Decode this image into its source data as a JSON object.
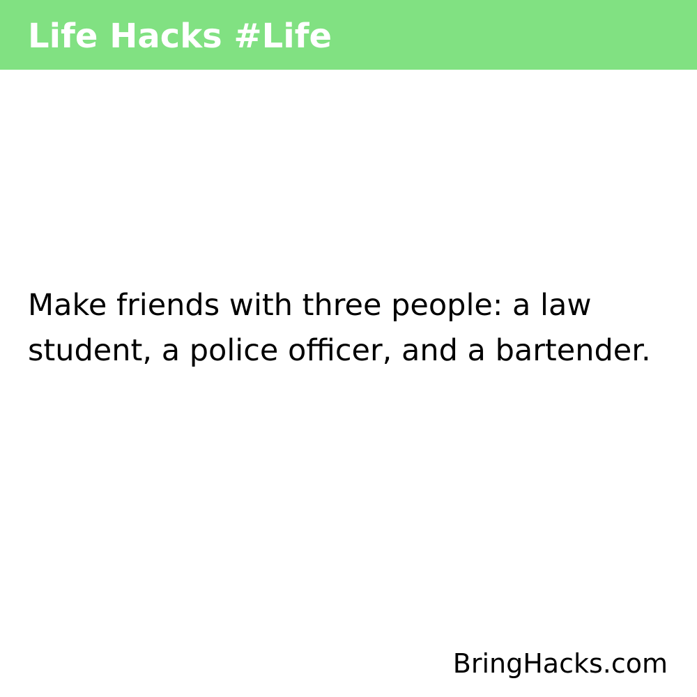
{
  "header": {
    "title": "Life Hacks #Life",
    "background_color": "#81e182",
    "text_color": "#ffffff"
  },
  "main": {
    "hack_text": "Make friends with three people: a law student, a police officer, and a bartender."
  },
  "footer": {
    "site": "BringHacks.com"
  }
}
